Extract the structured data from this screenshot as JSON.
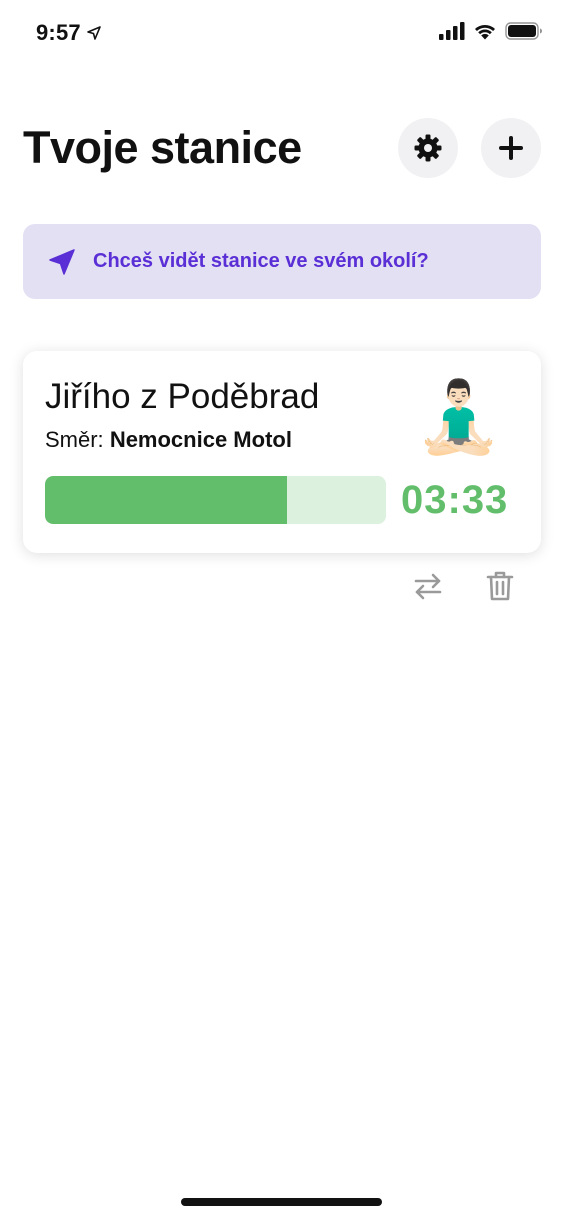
{
  "status_bar": {
    "time": "9:57",
    "icons": [
      "location-arrow-icon",
      "cellular-signal-icon",
      "wifi-icon",
      "battery-icon"
    ]
  },
  "header": {
    "title": "Tvoje stanice",
    "settings_icon": "gear-icon",
    "add_icon": "plus-icon"
  },
  "location_banner": {
    "icon": "navigation-arrow-icon",
    "text": "Chceš vidět stanice ve svém okolí?",
    "color": "#5a2fd6",
    "background": "#e3e0f3"
  },
  "station": {
    "name": "Jiřího z Poděbrad",
    "direction_label": "Směr:",
    "direction_value": "Nemocnice Motol",
    "emoji": "🧘🏻‍♂️",
    "countdown": "03:33",
    "progress": 0.71,
    "accent_color": "#63be6c",
    "actions": {
      "swap_icon": "swap-arrows-icon",
      "delete_icon": "trash-icon"
    }
  }
}
